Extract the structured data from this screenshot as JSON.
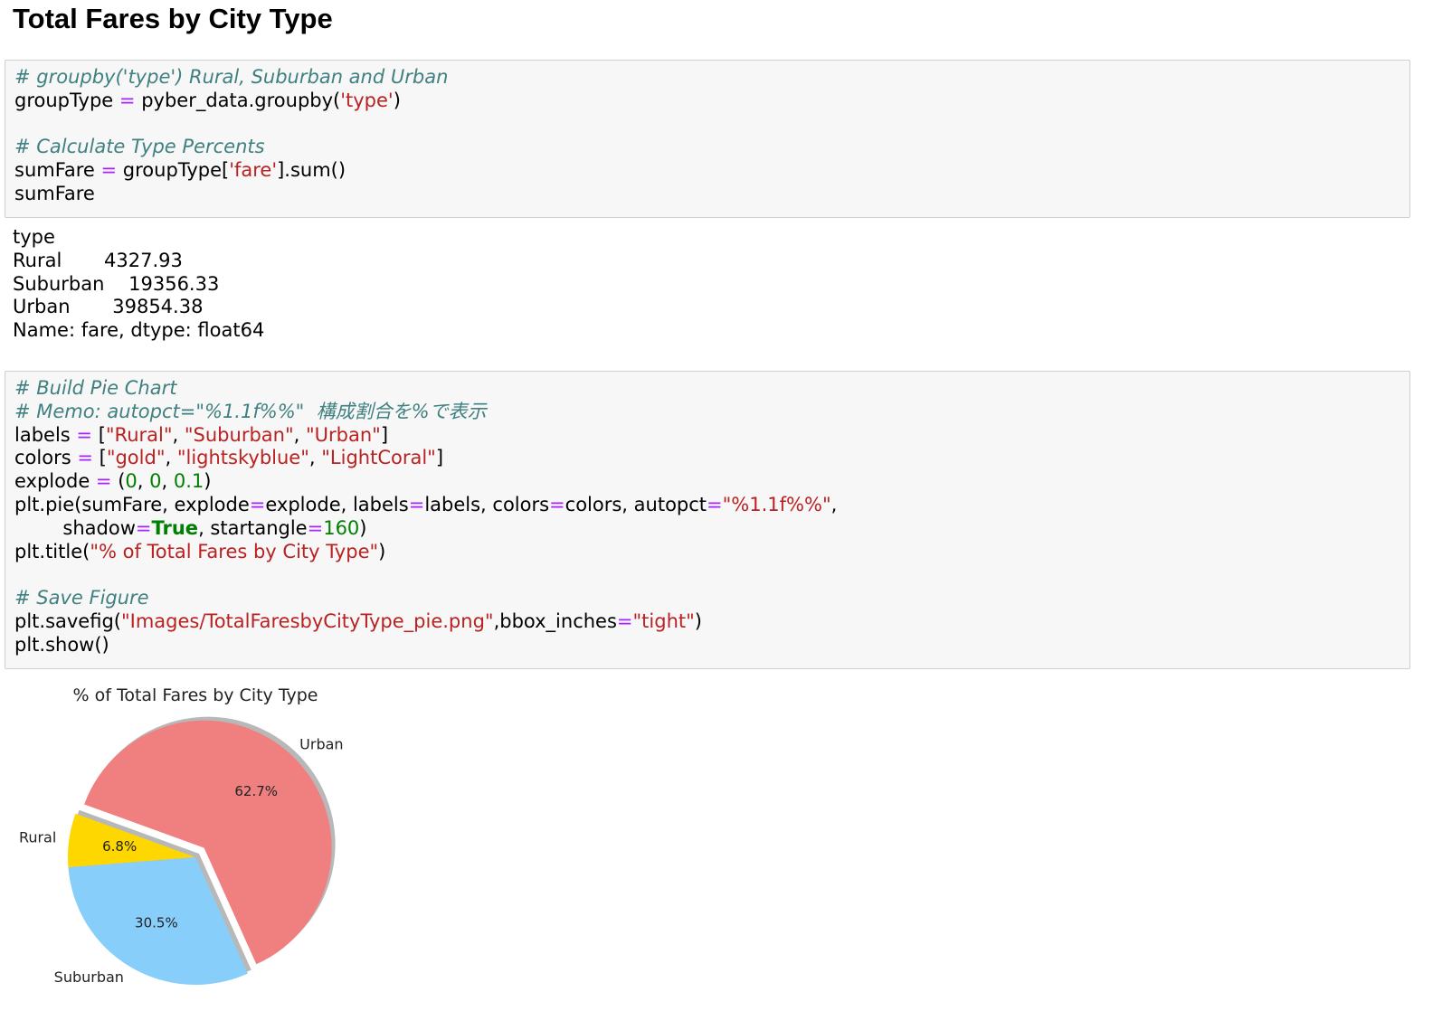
{
  "heading": "Total Fares by City Type",
  "cells": {
    "c1": {
      "l1": "# groupby('type') Rural, Suburban and Urban",
      "l2_a": "groupType ",
      "l2_op": "=",
      "l2_b": " pyber_data.groupby(",
      "l2_s": "'type'",
      "l2_c": ")",
      "l4": "# Calculate Type Percents",
      "l5_a": "sumFare ",
      "l5_op": "=",
      "l5_b": " groupType[",
      "l5_s": "'fare'",
      "l5_c": "].sum()",
      "l6": "sumFare"
    },
    "c2": {
      "l1": "# Build Pie Chart",
      "l2": "# Memo: autopct=\"%1.1f%%\"  構成割合を%で表示",
      "l3_a": "labels ",
      "l3_op": "=",
      "l3_b": " [",
      "l3_s1": "\"Rural\"",
      "l3_c1": ", ",
      "l3_s2": "\"Suburban\"",
      "l3_c2": ", ",
      "l3_s3": "\"Urban\"",
      "l3_e": "]",
      "l4_a": "colors ",
      "l4_op": "=",
      "l4_b": " [",
      "l4_s1": "\"gold\"",
      "l4_c1": ", ",
      "l4_s2": "\"lightskyblue\"",
      "l4_c2": ", ",
      "l4_s3": "\"LightCoral\"",
      "l4_e": "]",
      "l5_a": "explode ",
      "l5_op": "=",
      "l5_b": " (",
      "l5_n1": "0",
      "l5_c1": ", ",
      "l5_n2": "0",
      "l5_c2": ", ",
      "l5_n3": "0.1",
      "l5_e": ")",
      "l6_a": "plt.pie(sumFare, explode",
      "l6_op1": "=",
      "l6_b": "explode, labels",
      "l6_op2": "=",
      "l6_c": "labels, colors",
      "l6_op3": "=",
      "l6_d": "colors, autopct",
      "l6_op4": "=",
      "l6_s": "\"%1.1f%%\"",
      "l6_e": ",",
      "l7_a": "        shadow",
      "l7_op1": "=",
      "l7_kw": "True",
      "l7_b": ", startangle",
      "l7_op2": "=",
      "l7_n": "160",
      "l7_e": ")",
      "l8_a": "plt.title(",
      "l8_s": "\"% of Total Fares by City Type\"",
      "l8_e": ")",
      "l10": "# Save Figure",
      "l11_a": "plt.savefig(",
      "l11_s1": "\"Images/TotalFaresbyCityType_pie.png\"",
      "l11_b": ",bbox_inches",
      "l11_op": "=",
      "l11_s2": "\"tight\"",
      "l11_e": ")",
      "l12": "plt.show()"
    }
  },
  "output": {
    "l1": "type",
    "l2": "Rural       4327.93",
    "l3": "Suburban    19356.33",
    "l4": "Urban       39854.38",
    "l5": "Name: fare, dtype: float64"
  },
  "chart_data": {
    "type": "pie",
    "title": "% of Total Fares by City Type",
    "labels": [
      "Rural",
      "Suburban",
      "Urban"
    ],
    "values": [
      4327.93,
      19356.33,
      39854.38
    ],
    "percent_labels": [
      "6.8%",
      "30.5%",
      "62.7%"
    ],
    "colors": [
      "#ffd700",
      "#87cefa",
      "#f08080"
    ],
    "explode": [
      0,
      0,
      0.1
    ],
    "startangle": 160,
    "shadow": true
  }
}
